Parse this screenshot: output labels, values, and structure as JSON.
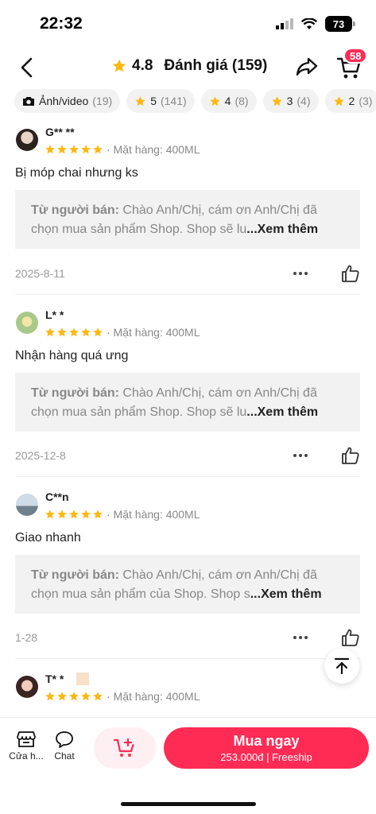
{
  "status": {
    "time": "22:32",
    "battery": "73"
  },
  "header": {
    "rating": "4.8",
    "title": "Đánh giá (159)",
    "cart_badge": "58"
  },
  "chips": [
    {
      "label": "Ảnh/video",
      "count": "(19)",
      "icon": "camera-icon"
    },
    {
      "label": "5",
      "count": "(141)",
      "icon": "star-icon"
    },
    {
      "label": "4",
      "count": "(8)",
      "icon": "star-icon"
    },
    {
      "label": "3",
      "count": "(4)",
      "icon": "star-icon"
    },
    {
      "label": "2",
      "count": "(3)",
      "icon": "star-icon"
    }
  ],
  "reviews": [
    {
      "user": "G** **",
      "stars": 5,
      "variant": "· Mặt hàng: 400ML",
      "text": "Bị móp chai nhưng ks",
      "seller_label": "Từ người bán:",
      "seller_text": " Chào Anh/Chị, cám ơn Anh/Chị đã chọn mua sản phẩm Shop. Shop sẽ lu",
      "more": "...Xem thêm",
      "date": "2025-8-11"
    },
    {
      "user": "L* *",
      "stars": 5,
      "variant": "· Mặt hàng: 400ML",
      "text": "Nhận hàng quá ưng",
      "seller_label": "Từ người bán:",
      "seller_text": " Chào Anh/Chị, cám ơn Anh/Chị đã chọn mua sản phẩm Shop. Shop sẽ lu",
      "more": "...Xem thêm",
      "date": "2025-12-8"
    },
    {
      "user": "C**n",
      "stars": 5,
      "variant": "· Mặt hàng: 400ML",
      "text": "Giao nhanh",
      "seller_label": "Từ người bán:",
      "seller_text": " Chào Anh/Chị, cám ơn Anh/Chị đã chọn mua sản phẩm của Shop. Shop s",
      "more": "...Xem thêm",
      "date": "1-28"
    },
    {
      "user": "T* *",
      "stars": 5,
      "variant": "· Mặt hàng: 400ML"
    }
  ],
  "bottom": {
    "shop_label": "Cửa h...",
    "chat_label": "Chat",
    "buy_label": "Mua ngay",
    "buy_sub": "253.000đ | Freeship"
  },
  "colors": {
    "accent": "#fe2c55",
    "star": "#fdb813"
  }
}
